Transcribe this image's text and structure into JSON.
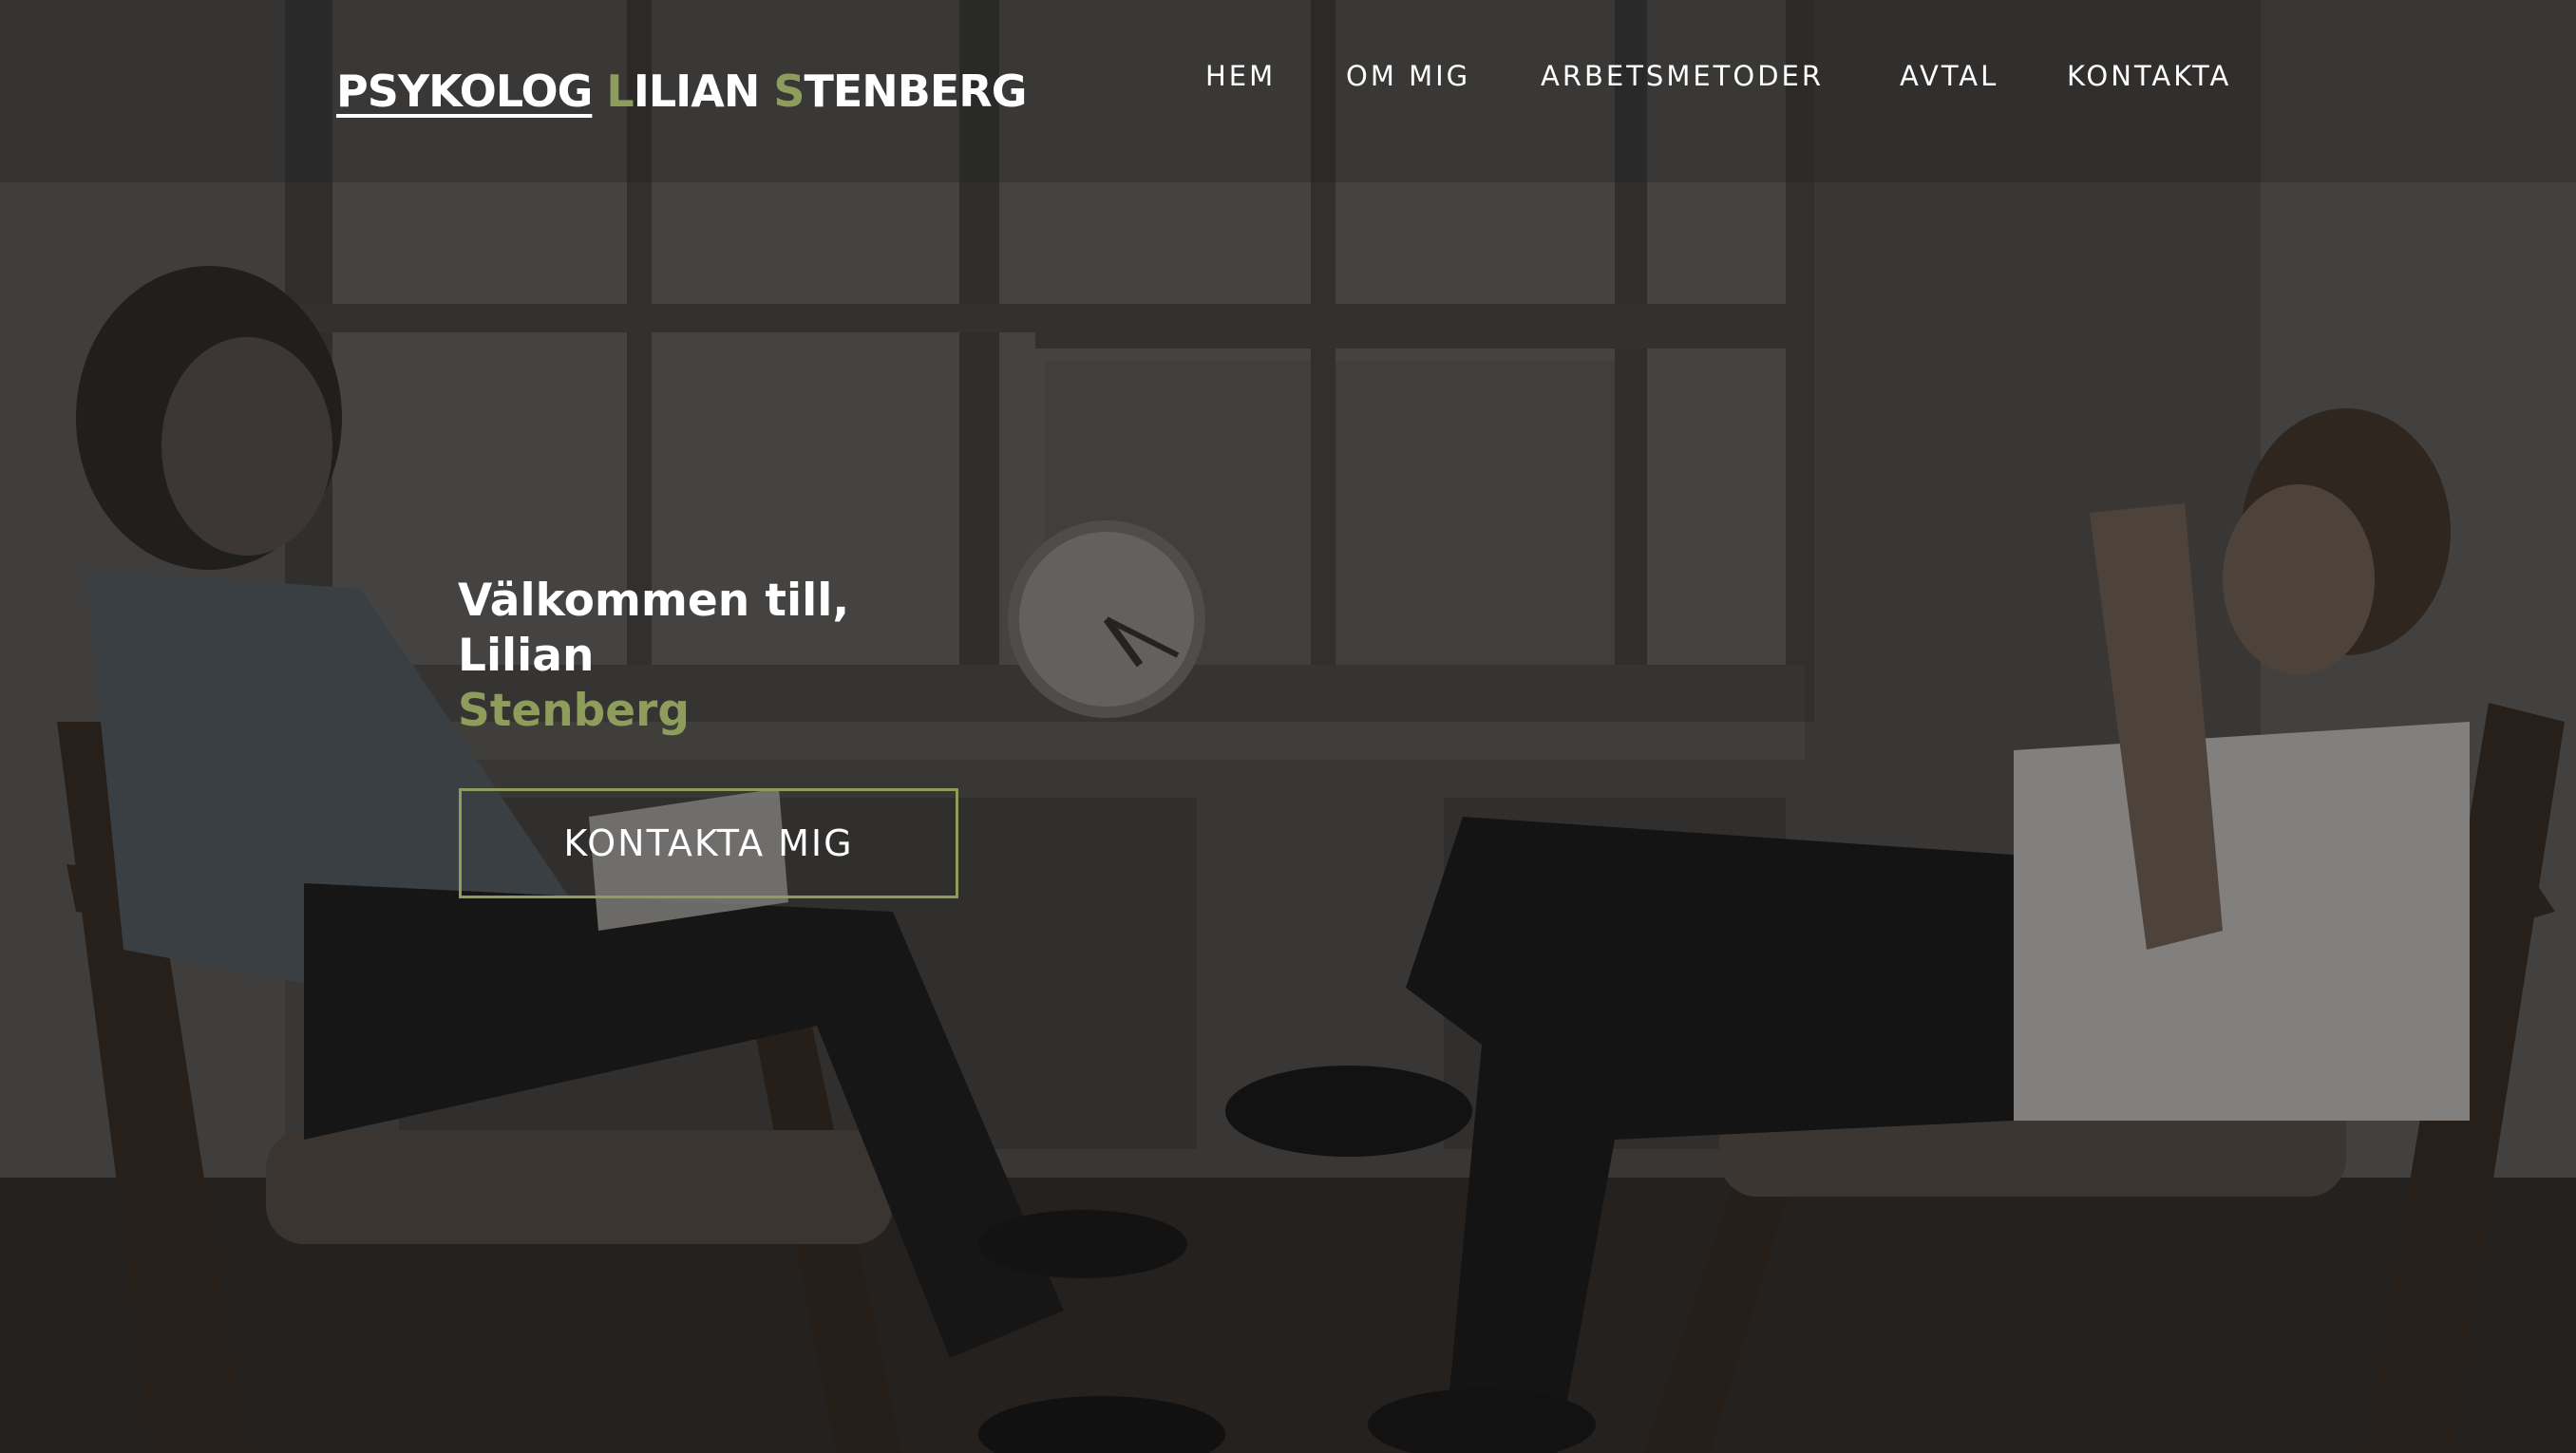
{
  "site": {
    "logo_part1": "PSYKOLOG",
    "logo_initial_first": "L",
    "logo_rest_first": "ILIAN",
    "logo_initial_last": "S",
    "logo_rest_last": "TENBERG"
  },
  "nav": {
    "items": [
      {
        "label": "HEM"
      },
      {
        "label": "OM MIG"
      },
      {
        "label": "ARBETSMETODER"
      },
      {
        "label": "AVTAL"
      },
      {
        "label": "KONTAKTA"
      }
    ]
  },
  "hero": {
    "welcome_line1": "Välkommen till,",
    "welcome_line2": "Lilian",
    "welcome_accent": "Stenberg",
    "cta_label": "KONTAKTA MIG"
  },
  "colors": {
    "accent": "#8e9d5c",
    "text": "#ffffff",
    "overlay": "#1e1e1e"
  }
}
